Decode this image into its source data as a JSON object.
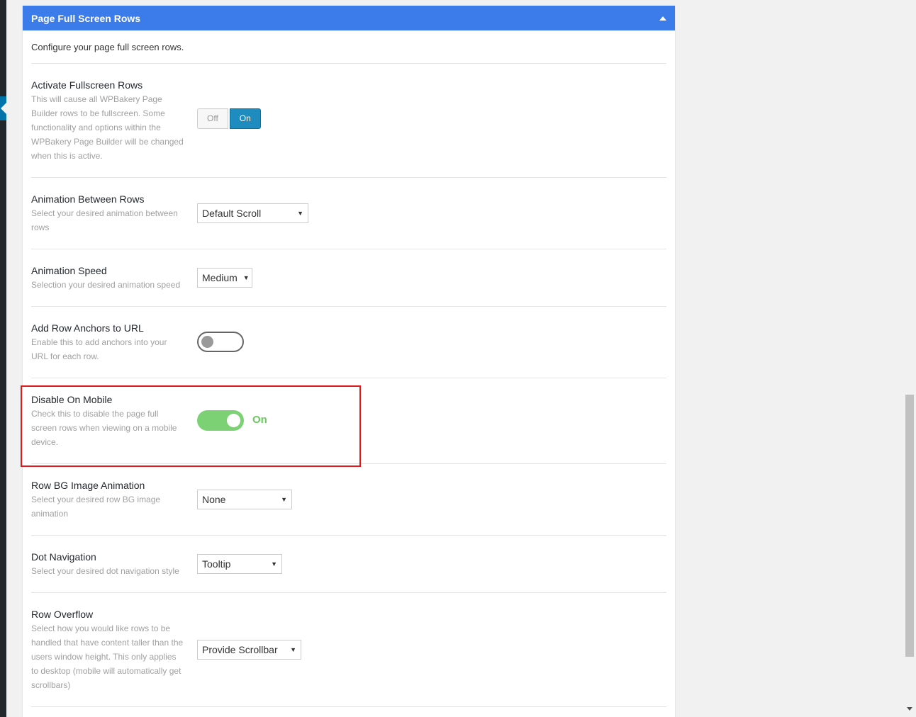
{
  "panel": {
    "title": "Page Full Screen Rows",
    "intro": "Configure your page full screen rows."
  },
  "settings": {
    "activate": {
      "title": "Activate Fullscreen Rows",
      "desc": "This will cause all WPBakery Page Builder rows to be fullscreen. Some functionality and options within the WPBakery Page Builder will be changed when this is active.",
      "off_label": "Off",
      "on_label": "On",
      "selected": "On"
    },
    "animation": {
      "title": "Animation Between Rows",
      "desc": "Select your desired animation between rows",
      "value": "Default Scroll"
    },
    "speed": {
      "title": "Animation Speed",
      "desc": "Selection your desired animation speed",
      "value": "Medium"
    },
    "anchors": {
      "title": "Add Row Anchors to URL",
      "desc": "Enable this to add anchors into your URL for each row.",
      "state": "off"
    },
    "mobile": {
      "title": "Disable On Mobile",
      "desc": "Check this to disable the page full screen rows when viewing on a mobile device.",
      "state_label": "On"
    },
    "bg_anim": {
      "title": "Row BG Image Animation",
      "desc": "Select your desired row BG image animation",
      "value": "None"
    },
    "dot_nav": {
      "title": "Dot Navigation",
      "desc": "Select your desired dot navigation style",
      "value": "Tooltip"
    },
    "overflow": {
      "title": "Row Overflow",
      "desc": "Select how you would like rows to be handled that have content taller than the users window height. This only applies to desktop (mobile will automatically get scrollbars)",
      "value": "Provide Scrollbar"
    }
  },
  "colors": {
    "header": "#3b7bea",
    "toggle_on": "#7bd174",
    "button_on": "#1e8cbe",
    "highlight": "#e01a1a"
  }
}
